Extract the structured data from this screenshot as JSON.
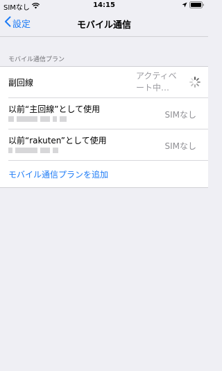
{
  "status_bar": {
    "carrier": "SIMなし",
    "time": "14:15",
    "icons": [
      "wifi-icon",
      "location-icon",
      "battery-icon"
    ]
  },
  "nav": {
    "back_label": "設定",
    "title": "モバイル通信"
  },
  "section": {
    "header": "モバイル通信プラン"
  },
  "plans": [
    {
      "label": "副回線",
      "value": "アクティベート中…"
    },
    {
      "label": "以前“主回線”として使用",
      "value": "SIMなし"
    },
    {
      "label": "以前“rakuten”として使用",
      "value": "SIMなし"
    }
  ],
  "add_plan_label": "モバイル通信プランを追加",
  "colors": {
    "accent": "#1d7bf6",
    "background": "#efeff4",
    "secondary_text": "#8e8e93"
  }
}
